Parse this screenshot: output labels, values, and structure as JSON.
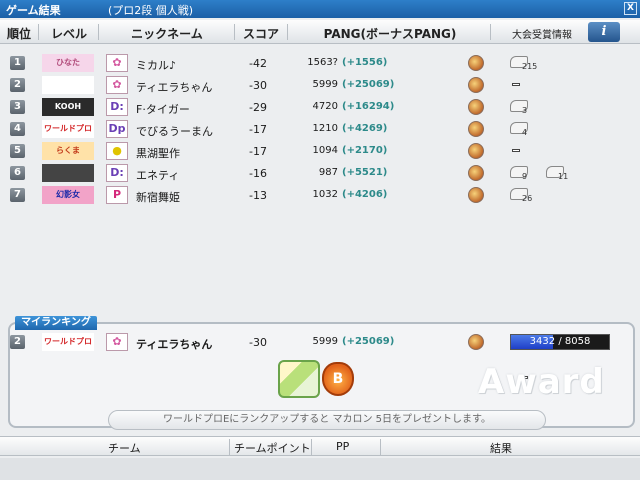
{
  "window": {
    "title": "ゲーム結果",
    "subtitle": "(プロ2段 個人戦)",
    "close_label": "X"
  },
  "header": {
    "rank": "順位",
    "level": "レベル",
    "nickname": "ニックネーム",
    "score": "スコア",
    "pang": "PANG(ボーナスPANG)",
    "award_info": "大会受賞情報",
    "info_button": "i"
  },
  "rows": [
    {
      "rank": "1",
      "level_text": "ひなた",
      "level_bg": "#f6d6ea",
      "level_color": "#b14a7a",
      "avatar": "✿",
      "avatar_color": "#d45aa0",
      "nick": "ミカル♪",
      "score": "-42",
      "pang": "1563?",
      "bonus": "(+1556)",
      "awards": [
        {
          "icon": "trophy-icon",
          "count": "215"
        }
      ]
    },
    {
      "rank": "2",
      "level_text": "",
      "level_bg": "#fff",
      "level_color": "#333",
      "avatar": "✿",
      "avatar_color": "#d45aa0",
      "nick": "ティエラちゃん",
      "score": "-30",
      "pang": "5999",
      "bonus": "(+25069)",
      "awards": []
    },
    {
      "rank": "3",
      "level_text": "KOOH MANIA",
      "level_bg": "#2a2a2a",
      "level_color": "#fff",
      "avatar": "D:",
      "avatar_color": "#6a3fb5",
      "nick": "F·タイガー",
      "score": "-29",
      "pang": "4720",
      "bonus": "(+16294)",
      "awards": [
        {
          "icon": "cup-icon",
          "count": "3"
        }
      ]
    },
    {
      "rank": "4",
      "level_text": "ワールドプロE",
      "level_bg": "#ffffff",
      "level_color": "#d4282a",
      "avatar": "Dp",
      "avatar_color": "#6a3fb5",
      "nick": "でびるうーまん",
      "score": "-17",
      "pang": "1210",
      "bonus": "(+4269)",
      "awards": [
        {
          "icon": "ring-icon",
          "count": "4"
        }
      ]
    },
    {
      "rank": "5",
      "level_text": "らくま",
      "level_bg": "#ffe2a8",
      "level_color": "#c23a1a",
      "avatar": "●",
      "avatar_color": "#e0c400",
      "nick": "黒湖聖作",
      "score": "-17",
      "pang": "1094",
      "bonus": "(+2170)",
      "awards": []
    },
    {
      "rank": "6",
      "level_text": "",
      "level_bg": "#444",
      "level_color": "#fff",
      "avatar": "D:",
      "avatar_color": "#6a3fb5",
      "nick": "エネティ",
      "score": "-16",
      "pang": "987",
      "bonus": "(+5521)",
      "awards": [
        {
          "icon": "feather-icon",
          "count": "9"
        },
        {
          "icon": "cup-icon",
          "count": "11"
        }
      ]
    },
    {
      "rank": "7",
      "level_text": "幻影女",
      "level_bg": "#f2a3c8",
      "level_color": "#1a2aa8",
      "avatar": "P",
      "avatar_color": "#d4287a",
      "nick": "新宿舞姫",
      "score": "-13",
      "pang": "1032",
      "bonus": "(+4206)",
      "awards": [
        {
          "icon": "cup-icon",
          "count": "26"
        }
      ]
    }
  ],
  "my_ranking": {
    "tab_label": "マイランキング",
    "rank": "2",
    "level_text": "ワールドプロE",
    "nick": "ティエラちゃん",
    "score": "-30",
    "pang": "5999",
    "bonus": "(+25069)",
    "exp_current": "3432",
    "exp_sep": "/",
    "exp_max": "8058",
    "exp_fraction": 0.426,
    "award_word": "Award",
    "notice": "ワールドプロEにランクアップすると マカロン 5日をプレゼントします。",
    "bag_label": "B"
  },
  "team_bar": {
    "team": "チーム",
    "team_point": "チームポイント",
    "pp": "PP",
    "result": "結果"
  },
  "colors": {
    "title": "#1b5fa6",
    "bonus": "#2d8a8a",
    "exp_fill": "#2f55d6"
  }
}
